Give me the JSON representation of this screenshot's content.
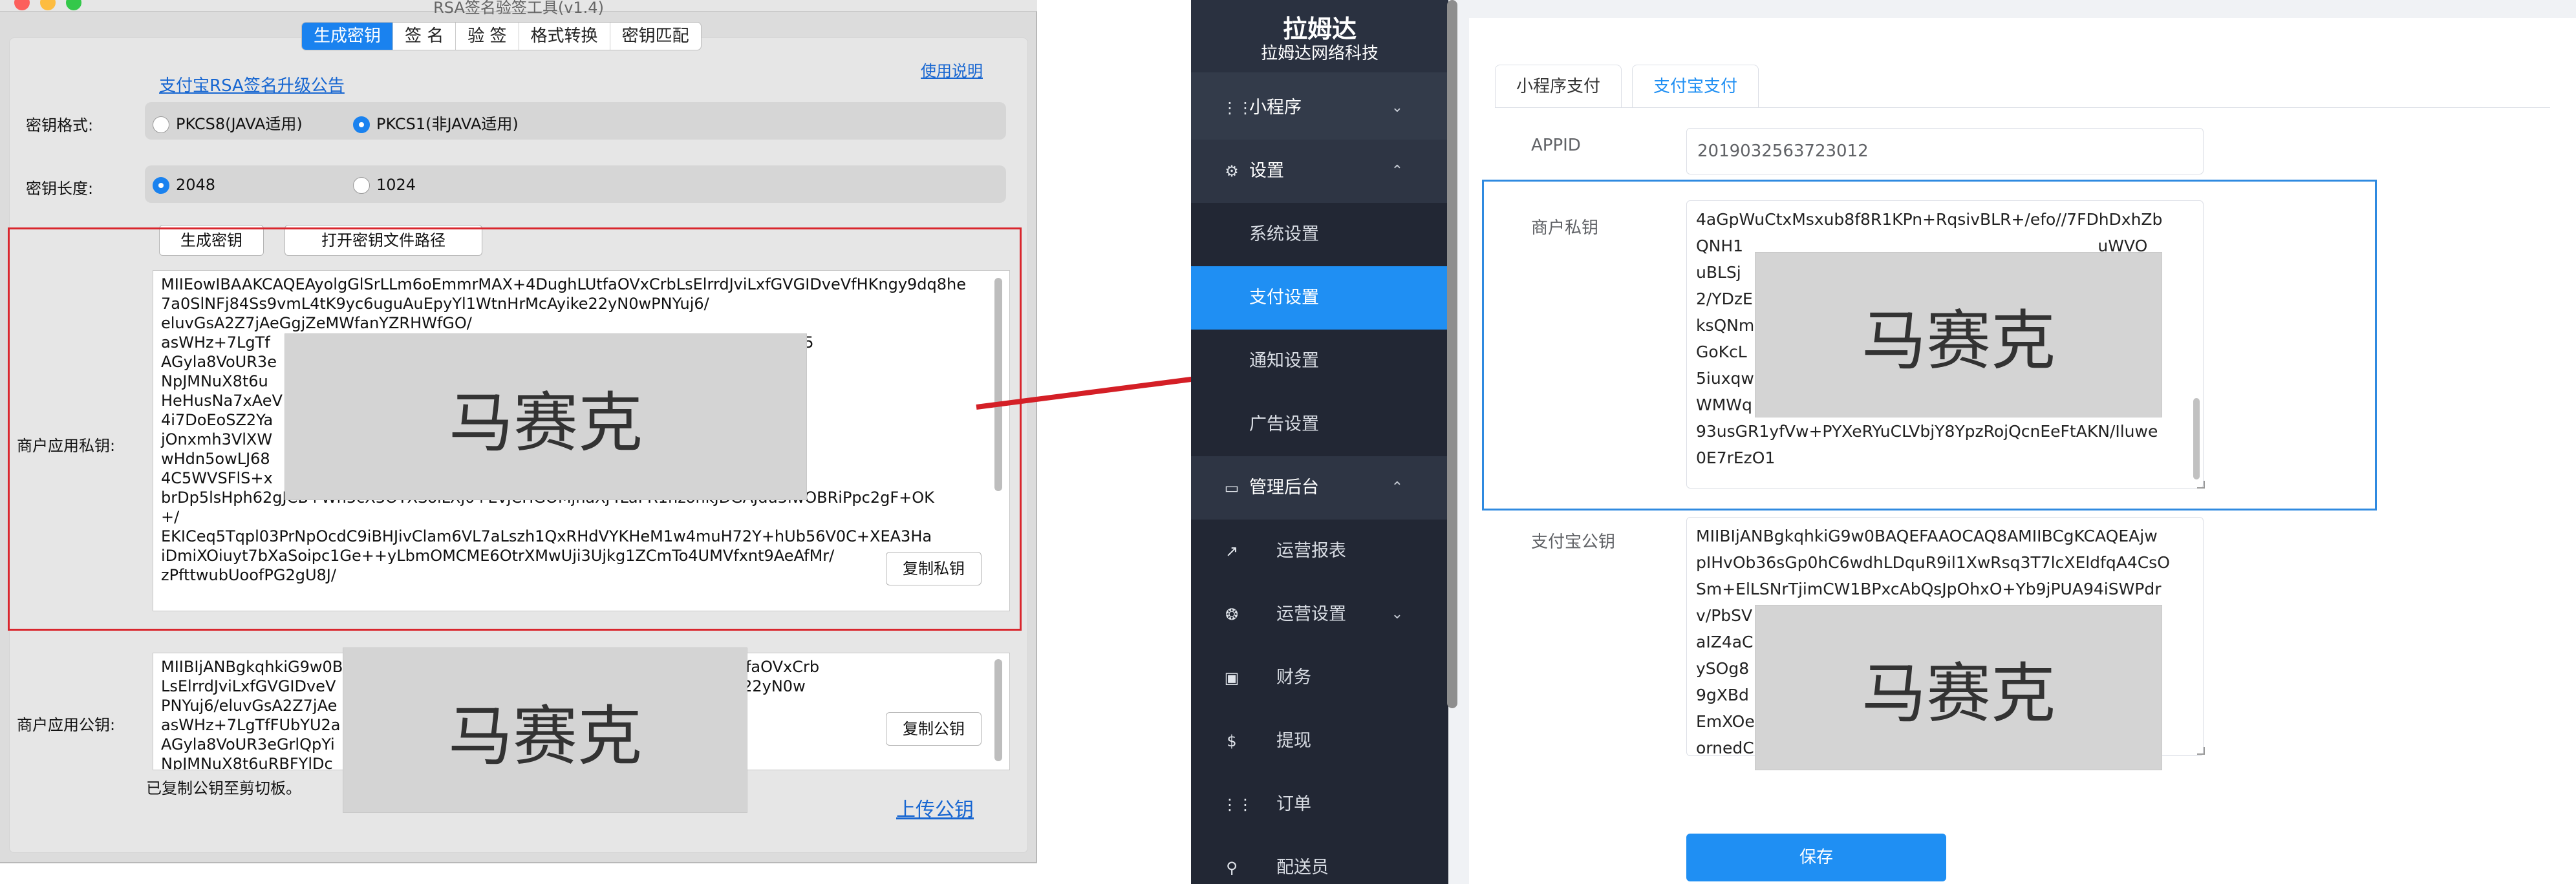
{
  "left_app": {
    "window_title": "RSA签名验签工具(v1.4)",
    "tabs": [
      "生成密钥",
      "签 名",
      "验 签",
      "格式转换",
      "密钥匹配"
    ],
    "upgrade_link": "支付宝RSA签名升级公告",
    "help_link": "使用说明",
    "key_format": {
      "label": "密钥格式:",
      "option1": "PKCS8(JAVA适用)",
      "option2": "PKCS1(非JAVA适用)",
      "selected": "PKCS1(非JAVA适用)"
    },
    "key_length": {
      "label": "密钥长度:",
      "option1": "2048",
      "option2": "1024",
      "selected": "2048"
    },
    "generate_button": "生成密钥",
    "open_path_button": "打开密钥文件路径",
    "private_key": {
      "label": "商户应用私钥:",
      "text": "MIIEowIBAAKCAQEAyolgGlSrLLm6oEmmrMAX+4DughLUtfaOVxCrbLsElrrdJviLxfGVGIDveVfHKngy9dq8he7a0SlNFj84Ss9vmL4tK9yc6uguAuEpyYl1WtnHrMcAyike22yN0wPNYuj6/\neluvGsA2Z7jAeGgjZeMWfanYZRHWfGO/\nasWHz+7LgTf                                                                              5WHKFbYrY8vXfc5i5\nAGyla8VoUR3e\nNpJMNuX8t6u                                                                          TM9B0oKtygwm3/\nHeHusNa7xAeV                                                                        3hJStaQQ/\n4i7DoEoSZ2Ya                                                                       RUsTm5gXFTbls9el/\njOnxmh3VlXW\nwHdn5owLJ68                                                                    RP+p89PzS3PZJ5Hn\n4C5WVSFlS+x                                                                   1HehGdQkyHyBGE8L\nbrDp5lsHph62gJCB+Wh5cX3OTXSoiLXj0+EvjCHGOMjhaXj4LaPR1nzohkJDGAJdu3lwOBRiPpc2gF+OK\n+/\nEKICeq5Tqpl03PrNpOcdC9iBHJivClam6VL7aLszh1QxRHdVYKHeM1w4muH72Y+hUb56V0C+XEA3Ha\niDmiXOiuyt7bXaSoipc1Ge++yLbmOMCME6OtrXMwUji3Ujkg1ZCmTo4UMVfxnt9AeAfMr/\nzPfttwubUoofPG2gU8J/",
      "copy_button": "复制私钥"
    },
    "public_key": {
      "label": "商户应用公钥:",
      "text": "MIIBIjANBgkqhkiG9w0B                                                 mmrMAX+4DughLUtfaOVxCrb\nLsElrrdJviLxfGVGIDveV                                                   pyYl1WtnHrMcAyike22yN0w\nPNYuj6/eluvGsA2Z7jAe\nasWHz+7LgTfFUbYU2a                                                       zClljSFt5WHKFbY\nAGyla8VoUR3eGrlQpYi\nNpJMNuX8t6uRBFYlDc",
      "copy_button": "复制公钥"
    },
    "status_text": "已复制公钥至剪切板。",
    "upload_link": "上传公钥",
    "mosaic_text": "马赛克"
  },
  "right_app": {
    "brand_title": "拉姆达",
    "brand_subtitle": "拉姆达网络科技",
    "menu": [
      {
        "label": "小程序",
        "icon": "grid-icon",
        "arrow": "chevron-down"
      },
      {
        "label": "设置",
        "icon": "gear-icon",
        "arrow": "chevron-up"
      },
      {
        "label": "系统设置",
        "sub": true
      },
      {
        "label": "支付设置",
        "sub": true,
        "selected": true
      },
      {
        "label": "通知设置",
        "sub": true
      },
      {
        "label": "广告设置",
        "sub": true
      },
      {
        "label": "管理后台",
        "icon": "monitor-icon",
        "arrow": "chevron-up"
      },
      {
        "label": "运营报表",
        "icon": "chart-icon",
        "sub": true
      },
      {
        "label": "运营设置",
        "icon": "settings-icon",
        "sub": true,
        "arrow": "chevron-down"
      },
      {
        "label": "财务",
        "icon": "money-icon",
        "sub": true
      },
      {
        "label": "提现",
        "icon": "dollar-icon",
        "sub": true
      },
      {
        "label": "订单",
        "icon": "grid-icon",
        "sub": true
      },
      {
        "label": "配送员",
        "icon": "bike-icon",
        "sub": true
      }
    ],
    "tabs": [
      "小程序支付",
      "支付宝支付"
    ],
    "active_tab": "支付宝支付",
    "appid_label": "APPID",
    "appid_value": "2019032563723012",
    "private_key_label": "商户私钥",
    "private_key_text": "4aGpWuCtxMsxub8f8R1KPn+RqsivBLR+/efo//7FDhDxhZb\nQNH1                                                                     uWVO\nuBLSj                                                                       KP\n2/YDzE\nksQNm                                                                     ZnE\nGoKcL                                                                     5F4\n5iuxqw                                                                    ge\nWMWq                                                               Mp\n93usGR1yfVw+PYXeRYuCLVbjY8YpzRojQcnEeFtAKN/Iluwe\n0E7rEzO1",
    "public_key_label": "支付宝公钥",
    "public_key_text": "MIIBIjANBgkqhkiG9w0BAQEFAAOCAQ8AMIIBCgKCAQEAjw\npIHvOb36sGp0hC6wdhLDquR9il1XwRsq3T7lcXEldfqA4CsO\nSm+ElLSNrTjimCW1BPxcAbQsJpOhxO+Yb9jPUA94iSWPdr\nv/PbSV                                                                     zhHf\naIZ4aC                                                                     Gxv\nySOg8                                                                     QJ5\n9gXBd                                                                     w+f\nEmXOe                                                                    Y3/\nornedC",
    "save_button": "保存",
    "mosaic_text": "马赛克"
  }
}
